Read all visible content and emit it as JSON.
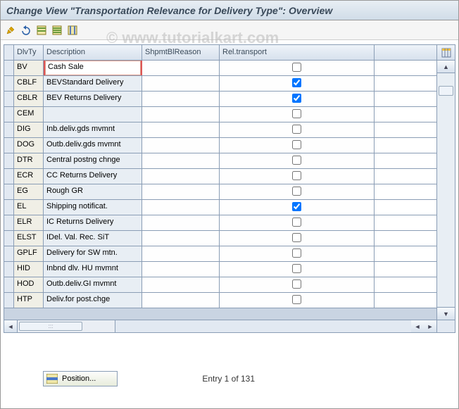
{
  "title": "Change View \"Transportation Relevance for Delivery Type\": Overview",
  "watermark": "© www.tutorialkart.com",
  "toolbar_icons": [
    "pencil",
    "undo",
    "save-row",
    "save-all",
    "table-sel"
  ],
  "columns": {
    "dlvty": "DlvTy",
    "desc": "Description",
    "shpm": "ShpmtBlReason",
    "rel": "Rel.transport"
  },
  "rows": [
    {
      "dlvty": "BV",
      "desc": "Cash Sale",
      "shpm": "",
      "rel": false,
      "selected": true
    },
    {
      "dlvty": "CBLF",
      "desc": "BEVStandard Delivery",
      "shpm": "",
      "rel": true
    },
    {
      "dlvty": "CBLR",
      "desc": "BEV Returns Delivery",
      "shpm": "",
      "rel": true
    },
    {
      "dlvty": "CEM",
      "desc": "",
      "shpm": "",
      "rel": false
    },
    {
      "dlvty": "DIG",
      "desc": "Inb.deliv.gds mvmnt",
      "shpm": "",
      "rel": false
    },
    {
      "dlvty": "DOG",
      "desc": "Outb.deliv.gds mvmnt",
      "shpm": "",
      "rel": false
    },
    {
      "dlvty": "DTR",
      "desc": "Central postng chnge",
      "shpm": "",
      "rel": false
    },
    {
      "dlvty": "ECR",
      "desc": "CC Returns Delivery",
      "shpm": "",
      "rel": false
    },
    {
      "dlvty": "EG",
      "desc": "Rough GR",
      "shpm": "",
      "rel": false
    },
    {
      "dlvty": "EL",
      "desc": "Shipping notificat.",
      "shpm": "",
      "rel": true
    },
    {
      "dlvty": "ELR",
      "desc": "IC Returns Delivery",
      "shpm": "",
      "rel": false
    },
    {
      "dlvty": "ELST",
      "desc": "IDel. Val. Rec. SiT",
      "shpm": "",
      "rel": false
    },
    {
      "dlvty": "GPLF",
      "desc": "Delivery for SW mtn.",
      "shpm": "",
      "rel": false
    },
    {
      "dlvty": "HID",
      "desc": "Inbnd dlv. HU mvmnt",
      "shpm": "",
      "rel": false
    },
    {
      "dlvty": "HOD",
      "desc": "Outb.deliv.GI mvmnt",
      "shpm": "",
      "rel": false
    },
    {
      "dlvty": "HTP",
      "desc": "Deliv.for post.chge",
      "shpm": "",
      "rel": false
    }
  ],
  "footer": {
    "position_label": "Position...",
    "entry_text": "Entry 1 of 131"
  }
}
